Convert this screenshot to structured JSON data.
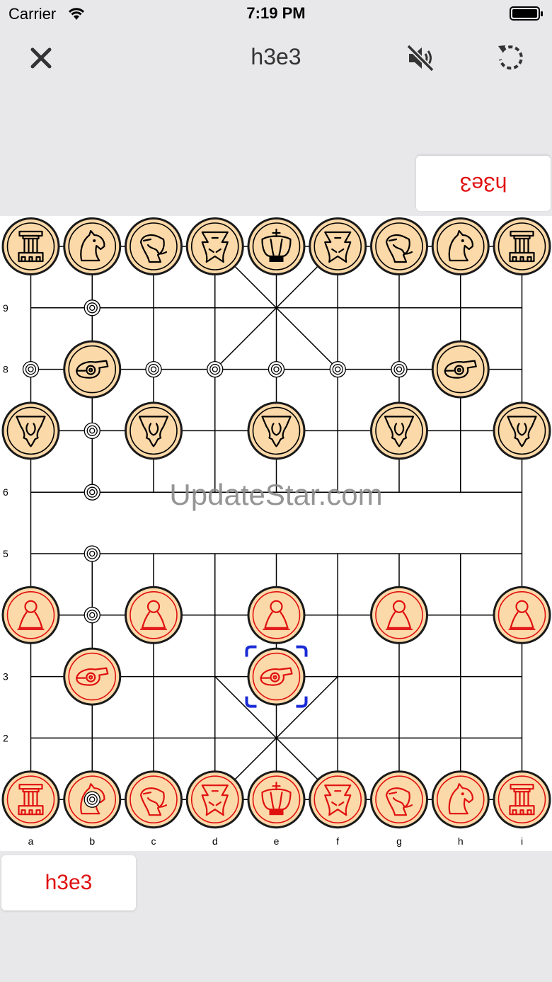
{
  "status_bar": {
    "carrier": "Carrier",
    "time": "7:19 PM"
  },
  "nav": {
    "title": "h3e3",
    "close_icon": "close-icon",
    "mute_icon": "speaker-muted-icon",
    "rotate_icon": "rotate-icon"
  },
  "opponent_move": "h3e3",
  "player_move": "h3e3",
  "watermark": "UpdateStar.com",
  "board": {
    "files": [
      "a",
      "b",
      "c",
      "d",
      "e",
      "f",
      "g",
      "h",
      "i"
    ],
    "ranks": [
      "9",
      "8",
      "6",
      "5",
      "3",
      "2"
    ],
    "colors": {
      "line": "#000000",
      "piece_fill": "#fcd9a8",
      "red": "#e01010",
      "black": "#000000",
      "selection": "#1a2bd6"
    },
    "black_pieces": [
      {
        "name": "chariot",
        "file": "a",
        "rank": 10
      },
      {
        "name": "horse",
        "file": "b",
        "rank": 10
      },
      {
        "name": "elephant",
        "file": "c",
        "rank": 10
      },
      {
        "name": "advisor",
        "file": "d",
        "rank": 10
      },
      {
        "name": "general",
        "file": "e",
        "rank": 10
      },
      {
        "name": "advisor",
        "file": "f",
        "rank": 10
      },
      {
        "name": "elephant",
        "file": "g",
        "rank": 10
      },
      {
        "name": "horse",
        "file": "h",
        "rank": 10
      },
      {
        "name": "chariot",
        "file": "i",
        "rank": 10
      },
      {
        "name": "cannon",
        "file": "b",
        "rank": 8
      },
      {
        "name": "cannon",
        "file": "h",
        "rank": 8
      },
      {
        "name": "soldier",
        "file": "a",
        "rank": 7
      },
      {
        "name": "soldier",
        "file": "c",
        "rank": 7
      },
      {
        "name": "soldier",
        "file": "e",
        "rank": 7
      },
      {
        "name": "soldier",
        "file": "g",
        "rank": 7
      },
      {
        "name": "soldier",
        "file": "i",
        "rank": 7
      }
    ],
    "red_pieces": [
      {
        "name": "soldier",
        "file": "a",
        "rank": 4
      },
      {
        "name": "soldier",
        "file": "c",
        "rank": 4
      },
      {
        "name": "soldier",
        "file": "e",
        "rank": 4
      },
      {
        "name": "soldier",
        "file": "g",
        "rank": 4
      },
      {
        "name": "soldier",
        "file": "i",
        "rank": 4
      },
      {
        "name": "cannon",
        "file": "b",
        "rank": 3
      },
      {
        "name": "cannon",
        "file": "e",
        "rank": 3,
        "selected": true
      },
      {
        "name": "chariot",
        "file": "a",
        "rank": 1
      },
      {
        "name": "horse",
        "file": "b",
        "rank": 1
      },
      {
        "name": "elephant",
        "file": "c",
        "rank": 1
      },
      {
        "name": "advisor",
        "file": "d",
        "rank": 1
      },
      {
        "name": "general",
        "file": "e",
        "rank": 1
      },
      {
        "name": "advisor",
        "file": "f",
        "rank": 1
      },
      {
        "name": "elephant",
        "file": "g",
        "rank": 1
      },
      {
        "name": "horse",
        "file": "h",
        "rank": 1
      },
      {
        "name": "chariot",
        "file": "i",
        "rank": 1
      }
    ],
    "hint_markers": [
      {
        "file": "b",
        "rank": 9
      },
      {
        "file": "a",
        "rank": 8
      },
      {
        "file": "c",
        "rank": 8
      },
      {
        "file": "d",
        "rank": 8
      },
      {
        "file": "e",
        "rank": 8
      },
      {
        "file": "f",
        "rank": 8
      },
      {
        "file": "g",
        "rank": 8
      },
      {
        "file": "b",
        "rank": 7
      },
      {
        "file": "b",
        "rank": 6
      },
      {
        "file": "b",
        "rank": 5
      },
      {
        "file": "b",
        "rank": 4
      },
      {
        "file": "b",
        "rank": 1
      }
    ]
  }
}
